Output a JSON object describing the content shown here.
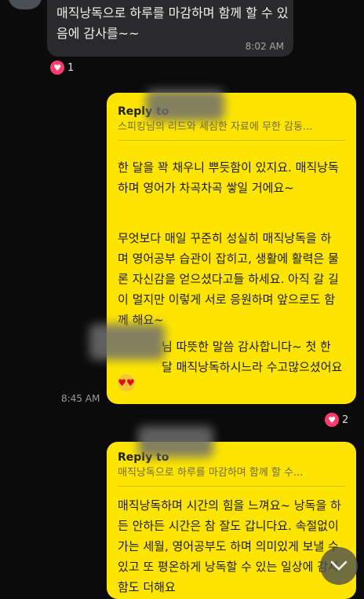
{
  "incoming": {
    "text": "매직낭독으로 하루를 마감하며 함께 할 수 있음에 감사를~~",
    "time": "8:02 AM",
    "reaction": {
      "icon": "heart-icon",
      "count": "1"
    }
  },
  "outgoing1": {
    "reply_label": "Reply to",
    "reply_quote": "스피킹님의 리드와 세심한 자료에 무한 감동...",
    "paragraph1": "한 달을 꽉 채우니 뿌듯함이 있지요. 매직낭독하며 영어가 차곡차곡 쌓일 거에요~",
    "paragraph2": "무엇보다 매일 꾸준히 성실히 매직낭독을 하며 영어공부 습관이 잡히고, 생활에 활력은 물론 자신감을 얻으셨다고들 하세요. 아직 갈 길이 멀지만 이렇게 서로 응원하며 앞으로도 함께 해요~",
    "paragraph3": "님 따뜻한 말씀 감사합니다~ 첫 한 달 매직낭독하시느라 수고많으셨어요",
    "time": "8:45 AM",
    "reaction": {
      "icon": "heart-icon",
      "count": "2"
    }
  },
  "outgoing2": {
    "reply_label": "Reply to",
    "reply_quote": "매직낭독으로 하루를 마감하며 함께 할 수...",
    "paragraph1": "매직낭독하며 시간의 힘을 느껴요~ 낭독을 하든 안하든 시간은 참 잘도 갑니다요. 속절없이 가는 세월, 영어공부도 하며 의미있게 보낼 수 있고 또 평온하게 낭독할 수 있는 일상에 감사함도 더해요"
  },
  "colors": {
    "bubble_out": "#fee500",
    "bubble_in": "#2a2a2c",
    "heart": "#ff3b70"
  }
}
